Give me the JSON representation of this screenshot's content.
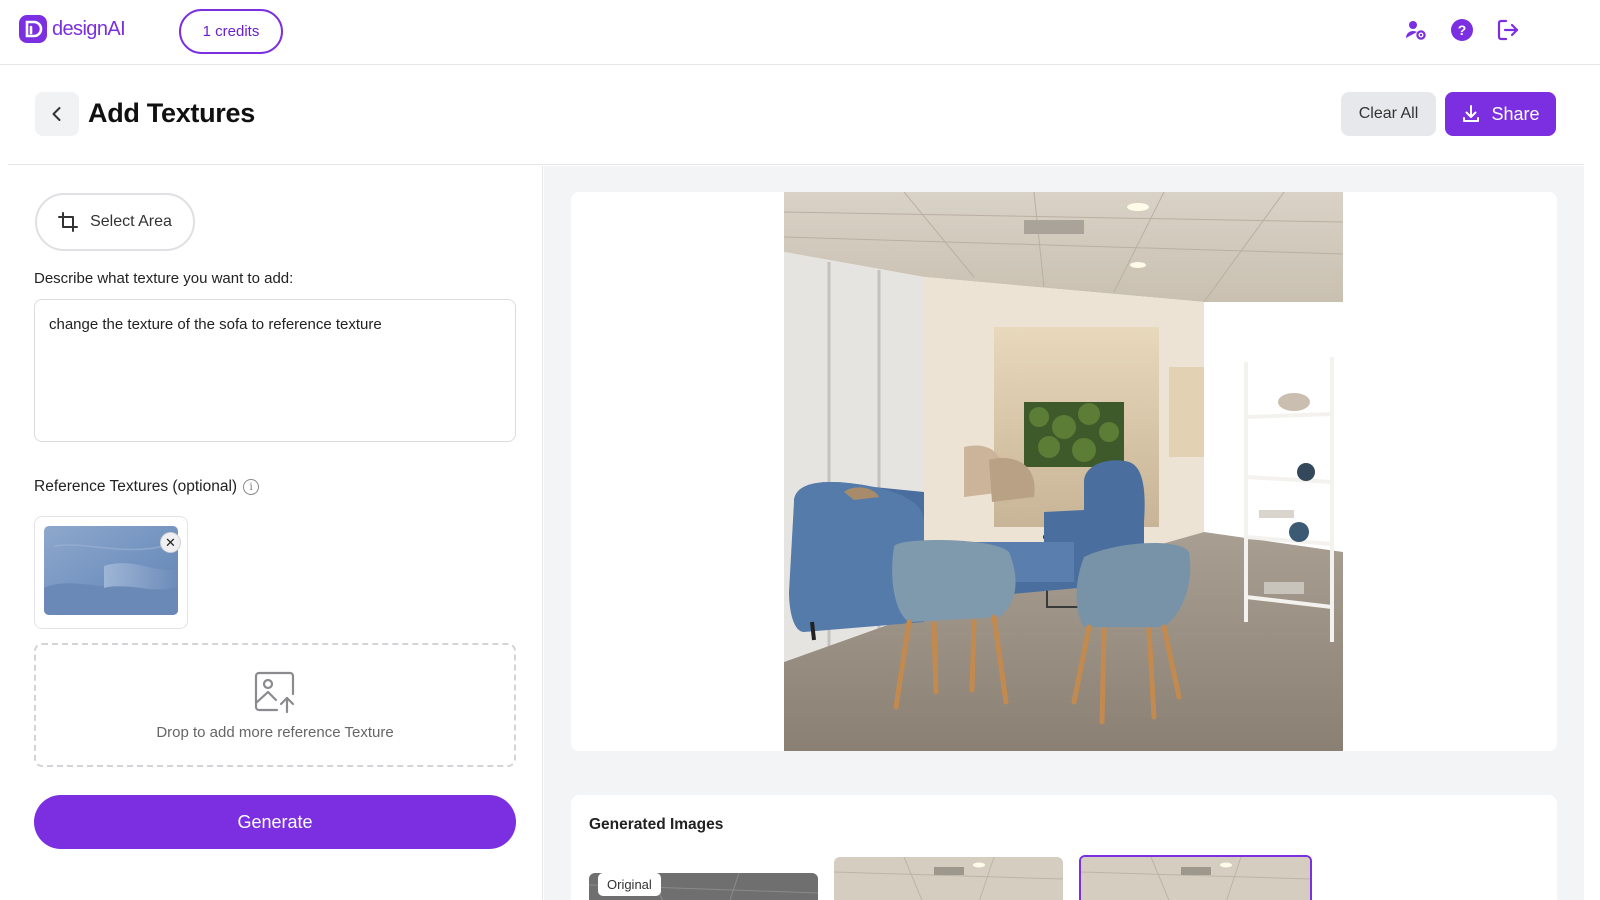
{
  "app": {
    "logo_text": "designAI",
    "credits_label": "1 credits"
  },
  "header": {
    "title": "Add Textures",
    "clear_label": "Clear All",
    "share_label": "Share"
  },
  "left_panel": {
    "select_area_label": "Select Area",
    "description_label": "Describe what texture you want to add:",
    "description_value": "change the texture of the sofa to reference texture",
    "reference_label": "Reference Textures (optional)",
    "drop_text": "Drop to add more reference Texture",
    "generate_label": "Generate"
  },
  "generated": {
    "title": "Generated Images",
    "original_tag": "Original"
  },
  "colors": {
    "accent": "#7b2fe0",
    "sofa": "#4a6f9e",
    "texture": "#7393c0",
    "page_bg": "#f3f4f6"
  }
}
